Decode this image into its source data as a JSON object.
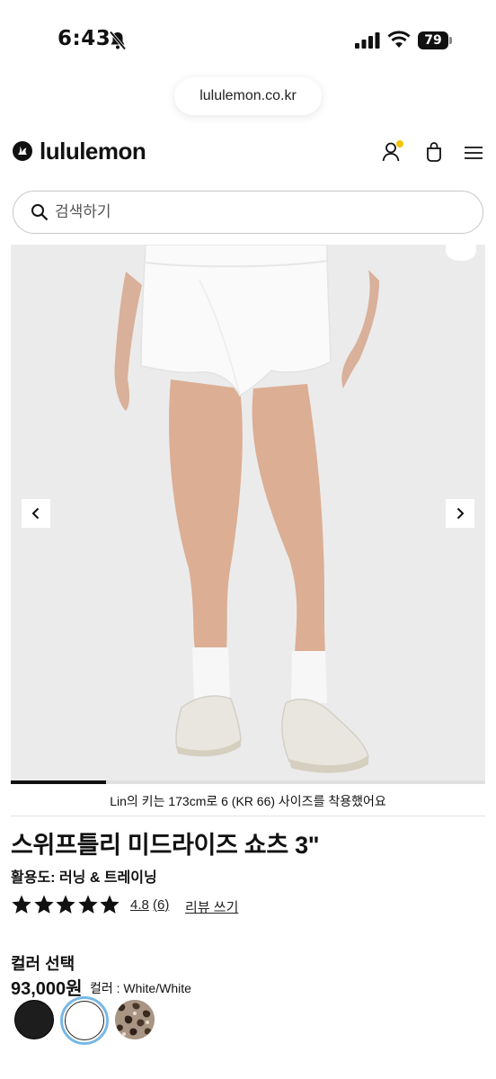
{
  "status_bar": {
    "time": "6:43",
    "battery": "79"
  },
  "browser": {
    "url": "lululemon.co.kr"
  },
  "header": {
    "brand": "lululemon",
    "icons": [
      "lululemon-logo-icon",
      "account-icon",
      "shopping-bag-icon",
      "menu-icon"
    ],
    "notification_dot_color": "#f2c500"
  },
  "search": {
    "placeholder": "검색하기"
  },
  "gallery": {
    "progress_fraction": 0.2,
    "caption": "Lin의 키는 173cm로 6 (KR 66) 사이즈를 착용했어요"
  },
  "product": {
    "title": "스위프틀리 미드라이즈 쇼츠 3\"",
    "activity_label": "활용도:",
    "activity_value": "러닝 & 트레이닝",
    "rating": {
      "stars": 5,
      "score": "4.8",
      "count": "(6)",
      "write_review": "리뷰 쓰기"
    },
    "color_heading": "컬러 선택",
    "price": "93,000원",
    "color_label": "컬러 : White/White",
    "swatches": [
      {
        "name": "Black",
        "color": "#1d1d1d",
        "selected": false
      },
      {
        "name": "White/White",
        "color": "#ffffff",
        "selected": true
      },
      {
        "name": "Leopard",
        "color": "#a99583",
        "selected": false
      }
    ],
    "selected_ring_color": "#77b8e6"
  }
}
